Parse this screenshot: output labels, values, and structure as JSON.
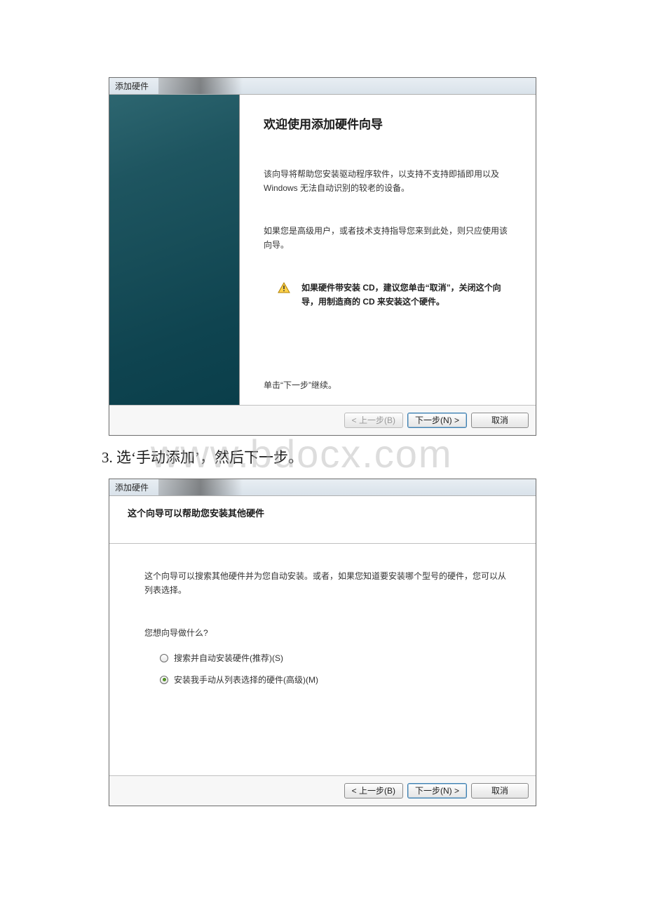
{
  "dialog1": {
    "titlebar": "添加硬件",
    "heading": "欢迎使用添加硬件向导",
    "para1": "该向导将帮助您安装驱动程序软件，以支持不支持即插即用以及 Windows 无法自动识别的较老的设备。",
    "para2": "如果您是高级用户，或者技术支持指导您来到此处，则只应使用该向导。",
    "warning": "如果硬件带安装 CD，建议您单击“取消”，关闭这个向导，用制造商的 CD 来安装这个硬件。",
    "continue_hint": "单击“下一步”继续。",
    "btn_back": "< 上一步(B)",
    "btn_next": "下一步(N) >",
    "btn_cancel": "取消"
  },
  "step_text": "3. 选‘手动添加’，然后下一步。",
  "watermark": "www.bdocx.com",
  "dialog2": {
    "titlebar": "添加硬件",
    "heading": "这个向导可以帮助您安装其他硬件",
    "para1": "这个向导可以搜索其他硬件并为您自动安装。或者，如果您知道要安装哪个型号的硬件，您可以从列表选择。",
    "question": "您想向导做什么?",
    "radio1": "搜索并自动安装硬件(推荐)(S)",
    "radio2": "安装我手动从列表选择的硬件(高级)(M)",
    "btn_back": "< 上一步(B)",
    "btn_next": "下一步(N) >",
    "btn_cancel": "取消"
  }
}
